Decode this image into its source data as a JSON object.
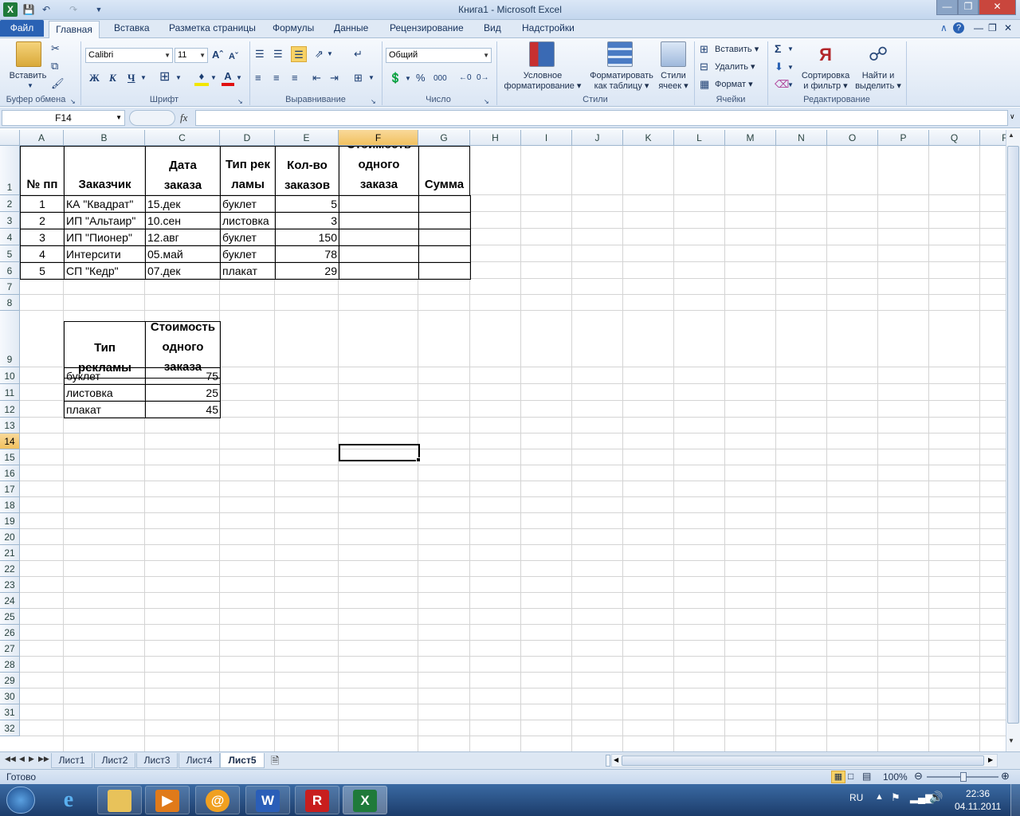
{
  "titlebar": {
    "title": "Книга1  -  Microsoft Excel",
    "undo_icon": "undo-icon",
    "redo_icon": "redo-icon",
    "save_icon": "save-icon"
  },
  "ribbon_tabs": {
    "file": "Файл",
    "home": "Главная",
    "insert": "Вставка",
    "layout": "Разметка страницы",
    "formulas": "Формулы",
    "data": "Данные",
    "review": "Рецензирование",
    "view": "Вид",
    "addins": "Надстройки"
  },
  "clipboard": {
    "paste": "Вставить",
    "label": "Буфер обмена"
  },
  "font": {
    "name": "Calibri",
    "size": "11",
    "bold": "Ж",
    "italic": "К",
    "underline": "Ч",
    "label": "Шрифт"
  },
  "alignment": {
    "label": "Выравнивание"
  },
  "number": {
    "format": "Общий",
    "percent": "%",
    "thousands": "000",
    "label": "Число"
  },
  "styles": {
    "conditional": "Условное форматирование",
    "conditional_l1": "Условное",
    "conditional_l2": "форматирование",
    "as_table_l1": "Форматировать",
    "as_table_l2": "как таблицу",
    "cell_styles_l1": "Стили",
    "cell_styles_l2": "ячеек",
    "label": "Стили"
  },
  "cells": {
    "insert": "Вставить",
    "delete": "Удалить",
    "format": "Формат",
    "label": "Ячейки"
  },
  "editing": {
    "sort_l1": "Сортировка",
    "sort_l2": "и фильтр",
    "find_l1": "Найти и",
    "find_l2": "выделить",
    "label": "Редактирование",
    "sigma": "Σ"
  },
  "formula_bar": {
    "name_box": "F14",
    "fx": "fx",
    "value": ""
  },
  "columns": [
    "A",
    "B",
    "C",
    "D",
    "E",
    "F",
    "G",
    "H",
    "I",
    "J",
    "K",
    "L",
    "M",
    "N",
    "O",
    "P",
    "Q",
    "R"
  ],
  "rows": [
    "1",
    "2",
    "3",
    "4",
    "5",
    "6",
    "7",
    "8",
    "9",
    "10",
    "11",
    "12",
    "13",
    "14",
    "15",
    "16",
    "17",
    "18",
    "19",
    "20",
    "21",
    "22",
    "23",
    "24",
    "25",
    "26",
    "27",
    "28",
    "29",
    "30",
    "31",
    "32"
  ],
  "table1": {
    "headers": {
      "a": "№ пп",
      "b": "Заказчик",
      "c": "Дата заказа",
      "d": "Тип рекламы",
      "e": "Кол-во заказов",
      "f": "Стоимость одного заказа",
      "g": "Сумма"
    },
    "rows": [
      {
        "n": "1",
        "client": "КА \"Квадрат\"",
        "date": "15.дек",
        "type": "буклет",
        "qty": "5"
      },
      {
        "n": "2",
        "client": "ИП \"Альтаир\"",
        "date": "10.сен",
        "type": "листовка",
        "qty": "3"
      },
      {
        "n": "3",
        "client": "ИП \"Пионер\"",
        "date": "12.авг",
        "type": "буклет",
        "qty": "150"
      },
      {
        "n": "4",
        "client": "Интерсити",
        "date": "05.май",
        "type": "буклет",
        "qty": "78"
      },
      {
        "n": "5",
        "client": "СП \"Кедр\"",
        "date": "07.дек",
        "type": "плакат",
        "qty": "29"
      }
    ]
  },
  "table2": {
    "headers": {
      "type": "Тип рекламы",
      "cost": "Стоимость одного заказа"
    },
    "rows": [
      {
        "type": "буклет",
        "cost": "75"
      },
      {
        "type": "листовка",
        "cost": "25"
      },
      {
        "type": "плакат",
        "cost": "45"
      }
    ]
  },
  "sheets": [
    "Лист1",
    "Лист2",
    "Лист3",
    "Лист4",
    "Лист5"
  ],
  "active_sheet": "Лист5",
  "status": {
    "ready": "Готово",
    "zoom": "100%"
  },
  "taskbar": {
    "lang": "RU",
    "time": "22:36",
    "date": "04.11.2011"
  }
}
